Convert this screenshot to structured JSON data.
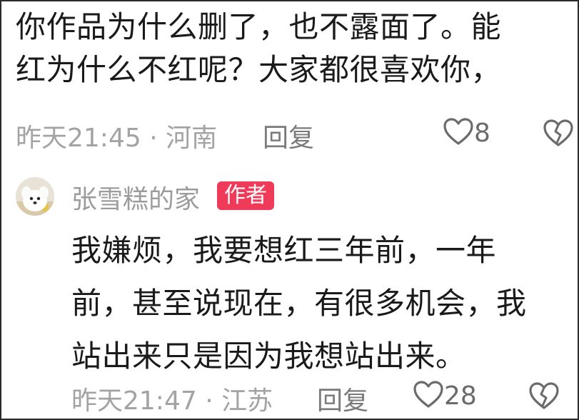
{
  "comment1": {
    "lines": [
      "你作品为什么删了，也不露面了。能",
      "红为什么不红呢？大家都很喜欢你，"
    ],
    "time": "昨天21:45",
    "separator": "·",
    "location": "河南",
    "reply_label": "回复",
    "like_count": "8",
    "like_icon": "heart-outline",
    "dislike_icon": "broken-heart-outline"
  },
  "reply": {
    "avatar_icon": "white-dog-avatar",
    "username": "张雪糕的家",
    "badge": "作者",
    "lines": [
      "我嫌烦，我要想红三年前，一年",
      "前，甚至说现在，有很多机会，我",
      "站出来只是因为我想站出来。"
    ],
    "time": "昨天21:47",
    "separator": "·",
    "location": "江苏",
    "reply_label": "回复",
    "like_count": "28",
    "like_icon": "heart-outline",
    "dislike_icon": "broken-heart-outline"
  },
  "colors": {
    "badge_bg": "#f03a5a",
    "text": "#1a1a1a",
    "meta": "#a3a3a3",
    "border": "#2b2b2b"
  }
}
